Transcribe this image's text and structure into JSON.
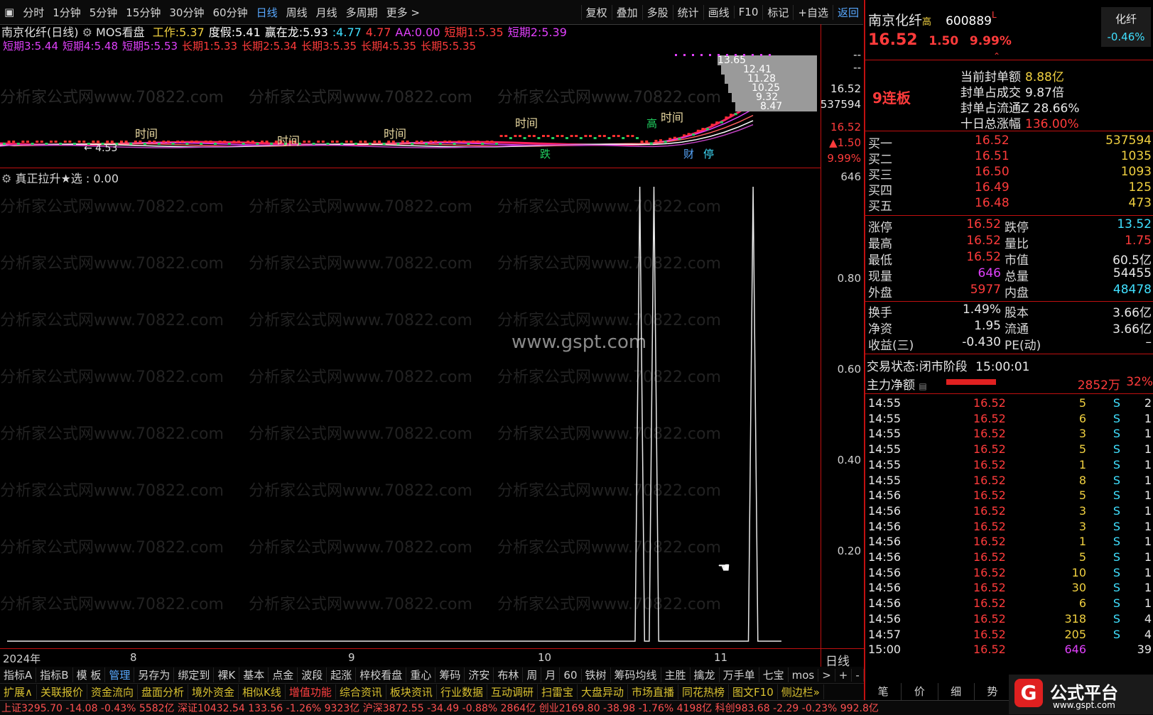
{
  "toolbar": {
    "periods": [
      "分时",
      "1分钟",
      "5分钟",
      "15分钟",
      "30分钟",
      "60分钟",
      "日线",
      "周线",
      "月线",
      "多周期",
      "更多 >"
    ],
    "active": "日线",
    "right": [
      "复权",
      "叠加",
      "多股",
      "统计",
      "画线",
      "F10",
      "标记",
      "+自选",
      "返回"
    ]
  },
  "header": {
    "stock": "南京化纤(日线)",
    "indicator": "MOS看盘",
    "items": [
      {
        "label": "工作:",
        "value": "5.37",
        "color": "#f0d040"
      },
      {
        "label": "度假:",
        "value": "5.41",
        "color": "#ffffff"
      },
      {
        "label": "赢在龙:",
        "value": "5.93",
        "color": "#ffffff"
      },
      {
        "label": ":",
        "value": "4.77",
        "color": "#40e0ff"
      },
      {
        "label": "",
        "value": "4.77",
        "color": "#ff3b3b"
      },
      {
        "label": "AA:",
        "value": "0.00",
        "color": "#e040fb"
      },
      {
        "label": "短期1:",
        "value": "5.35",
        "color": "#ff3b3b"
      },
      {
        "label": "短期2:",
        "value": "5.39",
        "color": "#e040fb"
      }
    ],
    "line2": [
      {
        "label": "短期3:",
        "value": "5.44"
      },
      {
        "label": "短期4:",
        "value": "5.48"
      },
      {
        "label": "短期5:",
        "value": "5.53"
      },
      {
        "label": "长期1:",
        "value": "5.33"
      },
      {
        "label": "长期2:",
        "value": "5.34"
      },
      {
        "label": "长期3:",
        "value": "5.35"
      },
      {
        "label": "长期4:",
        "value": "5.35"
      },
      {
        "label": "长期5:",
        "value": "5.35"
      }
    ]
  },
  "price_chart": {
    "labels_time": [
      "时间",
      "时间",
      "时间",
      "时间",
      "时间"
    ],
    "labels_gao": "高",
    "label_die": "跌",
    "label_cai": "财",
    "label_ting": "停",
    "price_labels": [
      "13.65",
      "12.41",
      "11.28",
      "10.25",
      "9.32",
      "8.47"
    ],
    "low_label": "4.53"
  },
  "watermark": "分析家公式网www.70822.com",
  "center_watermark": "www.gspt.com",
  "indicator": {
    "title": "真正拉升★选",
    "value": "0.00",
    "series": [
      0,
      0,
      0,
      0,
      0,
      0,
      0,
      0,
      0,
      0,
      0,
      0,
      0,
      0,
      0,
      0,
      0,
      0,
      0,
      0,
      0,
      0,
      0,
      0,
      0,
      0,
      0,
      0,
      0,
      0,
      0,
      0,
      0,
      0,
      0,
      0,
      0,
      0,
      0,
      0,
      0,
      0,
      0,
      0,
      0,
      0,
      0,
      0,
      0,
      0,
      0,
      0,
      0,
      0,
      0,
      0,
      0,
      0,
      0,
      0,
      0,
      0,
      0,
      0,
      0,
      0,
      0,
      0,
      0,
      0,
      0,
      0,
      0,
      0,
      0,
      0,
      0,
      0,
      0,
      0,
      0,
      0,
      0,
      0,
      0,
      0,
      0,
      0,
      0,
      0,
      0,
      0,
      0,
      0,
      0,
      0,
      0,
      0,
      0,
      0,
      0,
      0,
      0,
      0,
      0,
      0,
      0,
      0,
      0,
      0,
      0,
      0,
      0,
      0,
      0,
      0,
      0,
      0,
      0,
      0,
      0,
      0,
      0,
      0,
      0,
      0,
      0,
      0,
      0,
      0,
      0,
      0,
      0,
      0,
      1,
      0,
      0,
      1,
      0,
      0,
      0,
      0,
      0,
      0,
      0,
      0,
      0,
      0,
      0,
      0,
      0,
      0,
      0,
      0,
      0,
      0,
      0,
      0,
      1,
      0,
      0,
      0,
      0,
      0,
      0
    ],
    "ylim": [
      0,
      1
    ],
    "yticks": [
      "0.80",
      "0.60",
      "0.40",
      "0.20"
    ]
  },
  "vaxis": {
    "top_labels": [
      "--",
      "--",
      "16.52",
      "537594",
      "16.52",
      "▲1.50",
      "9.99%"
    ],
    "ind_top": "646"
  },
  "time_axis": {
    "year": "2024年",
    "months": [
      "8",
      "9",
      "10",
      "11"
    ],
    "period": "日线"
  },
  "tabs1": [
    "指标A",
    "指标B",
    "模 板",
    "管理",
    "另存为",
    "绑定到",
    "裸K",
    "基本",
    "点金",
    "波段",
    "起涨",
    "梓校看盘",
    "重心",
    "筹码",
    "济安",
    "布林",
    "周",
    "月",
    "60",
    "铁树",
    "筹码均线",
    "主胜",
    "擒龙",
    "万手单",
    "七宝",
    "mos",
    ">",
    "+",
    "-"
  ],
  "tabs1_active": "管理",
  "tabs2": [
    "扩展∧",
    "关联报价",
    "资金流向",
    "盘面分析",
    "境外资金",
    "相似K线",
    "增值功能",
    "综合资讯",
    "板块资讯",
    "行业数据",
    "互动调研",
    "扫雷宝",
    "大盘异动",
    "市场直播",
    "同花热榜",
    "图文F10",
    "侧边栏»"
  ],
  "statusbar": "上证3295.70 -14.08 -0.43% 5582亿 深证10432.54 133.56 -1.26% 9323亿 沪深3872.55 -34.49 -0.88% 2864亿 创业2169.80 -38.98 -1.76% 4198亿 科创983.68 -2.29 -0.23% 992.8亿",
  "right_panel": {
    "name": "南京化纤",
    "name_tag": "高",
    "code": "600889",
    "code_tag": "L",
    "sector": "化纤",
    "sector_change": "-0.46%",
    "price": "16.52",
    "change": "1.50",
    "change_pct": "9.99%",
    "limit_label": "9连板",
    "seal_info": [
      {
        "label": "当前封单额",
        "value": "8.88亿"
      },
      {
        "label": "封单占成交",
        "value": "9.87倍"
      },
      {
        "label": "封单占流通Z",
        "value": "28.66%"
      },
      {
        "label": "十日总涨幅",
        "value": "136.00%"
      }
    ],
    "bids": [
      {
        "label": "买一",
        "price": "16.52",
        "vol": "537594"
      },
      {
        "label": "买二",
        "price": "16.51",
        "vol": "1035"
      },
      {
        "label": "买三",
        "price": "16.50",
        "vol": "1093"
      },
      {
        "label": "买四",
        "price": "16.49",
        "vol": "125"
      },
      {
        "label": "买五",
        "price": "16.48",
        "vol": "473"
      }
    ],
    "stats": [
      {
        "l1": "涨停",
        "v1": "16.52",
        "l2": "跌停",
        "v2": "13.52",
        "c1": "#ff3b3b",
        "c2": "#40e0ff"
      },
      {
        "l1": "最高",
        "v1": "16.52",
        "l2": "量比",
        "v2": "1.75",
        "c1": "#ff3b3b",
        "c2": "#ff3b3b"
      },
      {
        "l1": "最低",
        "v1": "16.52",
        "l2": "市值",
        "v2": "60.5亿",
        "c1": "#ff3b3b",
        "c2": "#e8e8e8"
      },
      {
        "l1": "现量",
        "v1": "646",
        "l2": "总量",
        "v2": "54455",
        "c1": "#e040fb",
        "c2": "#e8e8e8"
      },
      {
        "l1": "外盘",
        "v1": "5977",
        "l2": "内盘",
        "v2": "48478",
        "c1": "#ff3b3b",
        "c2": "#40e0ff"
      }
    ],
    "stats2": [
      {
        "l1": "换手",
        "v1": "1.49%",
        "l2": "股本",
        "v2": "3.66亿"
      },
      {
        "l1": "净资",
        "v1": "1.95",
        "l2": "流通",
        "v2": "3.66亿"
      },
      {
        "l1": "收益(三)",
        "v1": "-0.430",
        "l2": "PE(动)",
        "v2": "–"
      }
    ],
    "trade_status_label": "交易状态:",
    "trade_status": "闭市阶段",
    "trade_time": "15:00:01",
    "main_flow_label": "主力净额",
    "main_flow": "2852万",
    "main_flow_pct": "32%",
    "main_flow_fraction": 0.32,
    "ticks": [
      {
        "t": "14:55",
        "p": "16.52",
        "v": "5",
        "s": "S",
        "n": "2"
      },
      {
        "t": "14:55",
        "p": "16.52",
        "v": "6",
        "s": "S",
        "n": "1"
      },
      {
        "t": "14:55",
        "p": "16.52",
        "v": "3",
        "s": "S",
        "n": "1"
      },
      {
        "t": "14:55",
        "p": "16.52",
        "v": "5",
        "s": "S",
        "n": "1"
      },
      {
        "t": "14:55",
        "p": "16.52",
        "v": "1",
        "s": "S",
        "n": "1"
      },
      {
        "t": "14:55",
        "p": "16.52",
        "v": "8",
        "s": "S",
        "n": "1"
      },
      {
        "t": "14:56",
        "p": "16.52",
        "v": "5",
        "s": "S",
        "n": "1"
      },
      {
        "t": "14:56",
        "p": "16.52",
        "v": "3",
        "s": "S",
        "n": "1"
      },
      {
        "t": "14:56",
        "p": "16.52",
        "v": "3",
        "s": "S",
        "n": "1"
      },
      {
        "t": "14:56",
        "p": "16.52",
        "v": "1",
        "s": "S",
        "n": "1"
      },
      {
        "t": "14:56",
        "p": "16.52",
        "v": "5",
        "s": "S",
        "n": "1"
      },
      {
        "t": "14:56",
        "p": "16.52",
        "v": "10",
        "s": "S",
        "n": "1"
      },
      {
        "t": "14:56",
        "p": "16.52",
        "v": "30",
        "s": "S",
        "n": "1"
      },
      {
        "t": "14:56",
        "p": "16.52",
        "v": "6",
        "s": "S",
        "n": "1"
      },
      {
        "t": "14:56",
        "p": "16.52",
        "v": "318",
        "s": "S",
        "n": "4"
      },
      {
        "t": "14:57",
        "p": "16.52",
        "v": "205",
        "s": "S",
        "n": "4"
      },
      {
        "t": "15:00",
        "p": "16.52",
        "v": "646",
        "s": "",
        "n": "39"
      }
    ],
    "bottom_tabs": [
      "笔",
      "价",
      "细",
      "势"
    ],
    "brand": "公式平台",
    "brand_url": "www.gspt.com"
  }
}
